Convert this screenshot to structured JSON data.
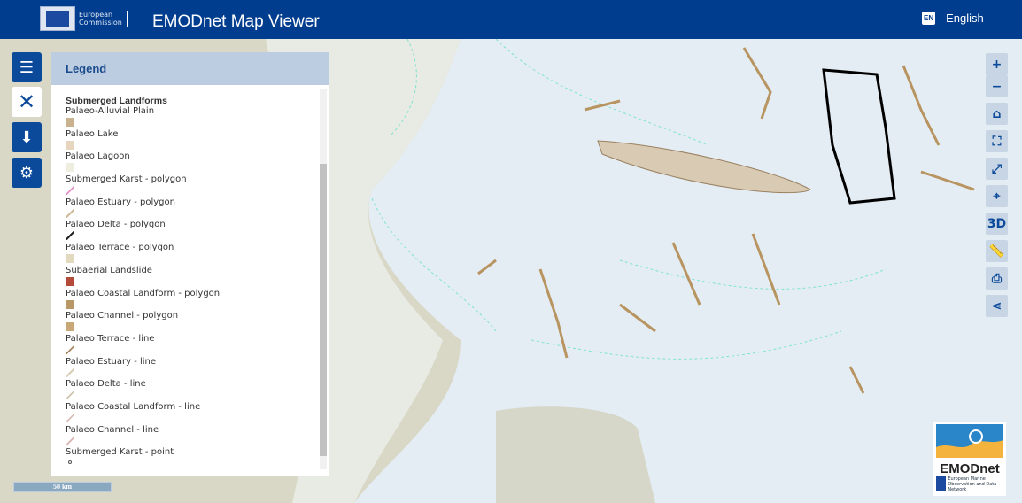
{
  "header": {
    "org_line1": "European",
    "org_line2": "Commission",
    "title": "EMODnet Map Viewer",
    "lang_code": "EN",
    "language": "English"
  },
  "sidebar": [
    {
      "icon": "layers-icon"
    },
    {
      "icon": "close-icon"
    },
    {
      "icon": "download-icon"
    },
    {
      "icon": "gear-icon"
    }
  ],
  "legend": {
    "title": "Legend",
    "group": "Submerged Landforms",
    "items": [
      {
        "label": "Palaeo-Alluvial Plain",
        "color": "#c9b28e"
      },
      {
        "label": "Palaeo Lake",
        "color": "#e6d6bf"
      },
      {
        "label": "Palaeo Lagoon",
        "color": "#efece0"
      },
      {
        "label": "Submerged Karst - polygon",
        "color": "#e58fc4"
      },
      {
        "label": "Palaeo Estuary - polygon",
        "color": "#cdbb99"
      },
      {
        "label": "Palaeo Delta - polygon",
        "color": "#222222"
      },
      {
        "label": "Palaeo Terrace - polygon",
        "color": "#e3d9bf"
      },
      {
        "label": "Subaerial Landslide",
        "color": "#b34a3a"
      },
      {
        "label": "Palaeo Coastal Landform - polygon",
        "color": "#b89866"
      },
      {
        "label": "Palaeo Channel - polygon",
        "color": "#c9a877"
      },
      {
        "label": "Palaeo Terrace - line",
        "color": "#aa8866"
      },
      {
        "label": "Palaeo Estuary - line",
        "color": "#d8cfb8"
      },
      {
        "label": "Palaeo Delta - line",
        "color": "#cfc6b0"
      },
      {
        "label": "Palaeo Coastal Landform - line",
        "color": "#d8c0b8"
      },
      {
        "label": "Palaeo Channel - line",
        "color": "#d9b3b0"
      },
      {
        "label": "Submerged Karst - point",
        "color": "#555555"
      }
    ]
  },
  "tools": [
    {
      "icon": "zoom-in-icon",
      "label": "+"
    },
    {
      "icon": "zoom-out-icon",
      "label": "−"
    },
    {
      "icon": "home-icon",
      "label": "⌂"
    },
    {
      "icon": "fullscreen-icon",
      "label": "⛶"
    },
    {
      "icon": "expand-icon",
      "label": "⤢"
    },
    {
      "icon": "locate-icon",
      "label": "⌖"
    },
    {
      "icon": "3d-icon",
      "label": "3D"
    },
    {
      "icon": "measure-icon",
      "label": "📏"
    },
    {
      "icon": "print-icon",
      "label": "⎙"
    },
    {
      "icon": "share-icon",
      "label": "⋖"
    }
  ],
  "scale_bar": "50 km",
  "logo": {
    "name": "EMODnet",
    "sub": "European Marine Observation and Data Network"
  },
  "colors": {
    "header": "#003d8f",
    "button": "#0b4a9a",
    "legend_header": "#bccde2"
  }
}
